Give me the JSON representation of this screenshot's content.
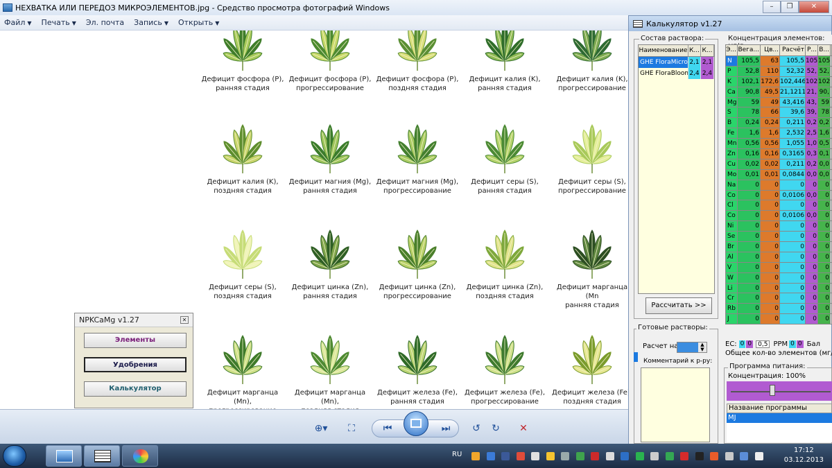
{
  "viewer": {
    "title": "НЕХВАТКА ИЛИ ПЕРЕДОЗ МИКРОЭЛЕМЕНТОВ.jpg - Средство просмотра фотографий Windows",
    "menu": [
      "Файл",
      "Печать",
      "Эл. почта",
      "Запись",
      "Открыть"
    ],
    "window_controls": [
      "minimize-icon",
      "restore-icon",
      "close-icon"
    ]
  },
  "photo": {
    "captions": [
      [
        "Дефицит фосфора (P),",
        "ранняя стадия"
      ],
      [
        "Дефицит фосфора (P),",
        "прогрессирование"
      ],
      [
        "Дефицит фосфора (P),",
        "поздняя стадия"
      ],
      [
        "Дефицит калия (K),",
        "ранняя стадия"
      ],
      [
        "Дефицит калия (K),",
        "прогрессирование"
      ],
      [
        "Дефицит калия (K),",
        "поздняя стадия"
      ],
      [
        "Дефицит магния (Mg),",
        "ранняя стадия"
      ],
      [
        "Дефицит магния (Mg),",
        "прогрессирование"
      ],
      [
        "Дефицит серы (S),",
        "ранняя стадия"
      ],
      [
        "Дефицит серы (S),",
        "прогрессирование"
      ],
      [
        "Дефицит серы (S),",
        "поздняя стадия"
      ],
      [
        "Дефицит цинка (Zn),",
        "ранняя стадия"
      ],
      [
        "Дефицит цинка (Zn),",
        "прогрессирование"
      ],
      [
        "Дефицит цинка (Zn),",
        "поздняя стадия"
      ],
      [
        "Дефицит марганца (Mn",
        "ранняя стадия"
      ],
      [
        "Дефицит марганца (Mn),",
        "прогрессирование"
      ],
      [
        "Дефицит марганца (Mn),",
        "поздняя стадия"
      ],
      [
        "Дефицит железа (Fe),",
        "ранняя стадия"
      ],
      [
        "Дефицит железа (Fe),",
        "прогрессирование"
      ],
      [
        "Дефицит железа (Fe),",
        "поздняя стадия"
      ]
    ]
  },
  "npk": {
    "title": "NPKCaMg v1.27",
    "btn_elements": "Элементы",
    "btn_fertilizers": "Удобрения",
    "btn_calculator": "Калькулятор"
  },
  "calc": {
    "title": "Калькулятор v1.27",
    "composition_label": "Состав раствора:",
    "sol_headers": [
      "Наименование",
      "К...",
      "К..."
    ],
    "solutions": [
      {
        "name": "GHE FloraMicro",
        "a": "2,1",
        "b": "2,1"
      },
      {
        "name": "GHE FloraBloom",
        "a": "2,4",
        "b": "2,4"
      }
    ],
    "btn_calculate": "Рассчитать >>",
    "ready_label": "Готовые растворы:",
    "calc_for_label": "Расчет на:",
    "comment_label": "Комментарий к р-ру:",
    "conc_label": "Концентрация элементов: мг/л.",
    "conc_headers": [
      "Э...",
      "Вега...",
      "Цв...",
      "Расчёт",
      "Р...",
      "В..."
    ],
    "rows": [
      [
        "N",
        "105,5",
        "63",
        "105,5",
        "105",
        "105"
      ],
      [
        "P",
        "52,8",
        "110",
        "52,32",
        "52,",
        "52,"
      ],
      [
        "K",
        "102,1",
        "172,6",
        "102,446",
        "102",
        "102"
      ],
      [
        "Ca",
        "90,8",
        "49,5",
        "21,1211",
        "21,",
        "90,"
      ],
      [
        "Mg",
        "59",
        "49",
        "43,416",
        "43,",
        "59"
      ],
      [
        "S",
        "78",
        "66",
        "39,6",
        "39,",
        "78"
      ],
      [
        "B",
        "0,24",
        "0,24",
        "0,211",
        "0,2",
        "0,2"
      ],
      [
        "Fe",
        "1,6",
        "1,6",
        "2,532",
        "2,5",
        "1,6"
      ],
      [
        "Mn",
        "0,56",
        "0,56",
        "1,055",
        "1,0",
        "0,5"
      ],
      [
        "Zn",
        "0,16",
        "0,16",
        "0,3165",
        "0,3",
        "0,1"
      ],
      [
        "Cu",
        "0,02",
        "0,02",
        "0,211",
        "0,2",
        "0,0"
      ],
      [
        "Mo",
        "0,01",
        "0,01",
        "0,0844",
        "0,0",
        "0,0"
      ],
      [
        "Na",
        "0",
        "0",
        "0",
        "0",
        "0"
      ],
      [
        "Co",
        "0",
        "0",
        "0,0106",
        "0,0",
        "0"
      ],
      [
        "Cl",
        "0",
        "0",
        "0",
        "0",
        "0"
      ],
      [
        "Co",
        "0",
        "0",
        "0,0106",
        "0,0",
        "0"
      ],
      [
        "Ni",
        "0",
        "0",
        "0",
        "0",
        "0"
      ],
      [
        "Se",
        "0",
        "0",
        "0",
        "0",
        "0"
      ],
      [
        "Br",
        "0",
        "0",
        "0",
        "0",
        "0"
      ],
      [
        "Al",
        "0",
        "0",
        "0",
        "0",
        "0"
      ],
      [
        "V",
        "0",
        "0",
        "0",
        "0",
        "0"
      ],
      [
        "W",
        "0",
        "0",
        "0",
        "0",
        "0"
      ],
      [
        "Li",
        "0",
        "0",
        "0",
        "0",
        "0"
      ],
      [
        "Cr",
        "0",
        "0",
        "0",
        "0",
        "0"
      ],
      [
        "Rb",
        "0",
        "0",
        "0",
        "0",
        "0"
      ],
      [
        "J",
        "0",
        "0",
        "0",
        "0",
        "0"
      ]
    ],
    "ec_label": "EC:",
    "ec_a": "0",
    "ec_b": "0",
    "ec_spin": "0,5",
    "ppm_label": "PPM",
    "ppm_a": "0",
    "ppm_b": "0",
    "bal_label": "Бал",
    "total_label": "Общее кол-во элементов (мг/л.):",
    "program_label": "Программа питания:",
    "concentration_label": "Концентрация: 100%",
    "program_name_header": "Название программы питания",
    "program_item": "MJ"
  },
  "taskbar": {
    "lang": "RU",
    "time": "17:12",
    "date": "03.12.2013"
  },
  "colors": {
    "veg": "#2bc25f",
    "bloom": "#dd7a2c",
    "calc": "#40d7f0",
    "purple": "#b15bd1",
    "selection": "#1c7ae0"
  }
}
